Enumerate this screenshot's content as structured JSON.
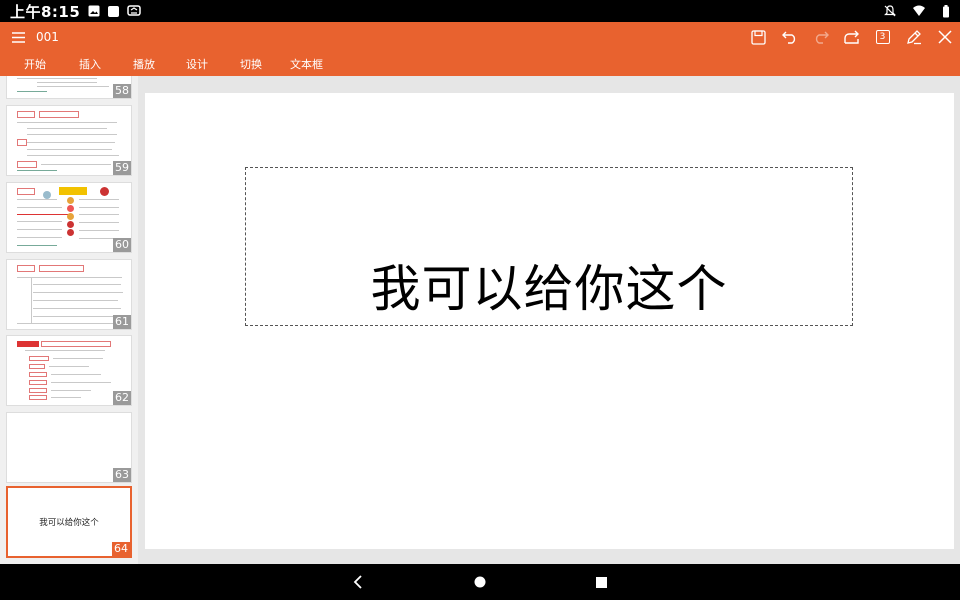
{
  "status_bar": {
    "time": "上午8:15",
    "left_icons": [
      "image-icon",
      "app-icon",
      "cast-icon"
    ],
    "right_icons": [
      "mute-icon",
      "wifi-icon",
      "battery-icon"
    ]
  },
  "title_bar": {
    "doc_name": "001",
    "tools": [
      "save-icon",
      "undo-icon",
      "redo-icon",
      "share-icon",
      "slide-count-icon",
      "pen-icon",
      "close-icon"
    ],
    "slide_count_badge": "3"
  },
  "menu": {
    "tabs": [
      "开始",
      "插入",
      "播放",
      "设计",
      "切换",
      "文本框"
    ]
  },
  "thumbnails": [
    {
      "number": "58",
      "content": "text-slide"
    },
    {
      "number": "59",
      "content": "table-slide"
    },
    {
      "number": "60",
      "content": "icon-slide"
    },
    {
      "number": "61",
      "content": "table-slide"
    },
    {
      "number": "62",
      "content": "list-slide"
    },
    {
      "number": "63",
      "content": "blank"
    },
    {
      "number": "64",
      "content": "text",
      "text": "我可以给你这个",
      "active": true
    }
  ],
  "slide": {
    "text": "我可以给你这个"
  },
  "nav_bar": {
    "buttons": [
      "back-icon",
      "home-icon",
      "recents-icon"
    ]
  },
  "colors": {
    "accent": "#E8622F",
    "status_bg": "#000000",
    "canvas_bg": "#E6E6E6"
  }
}
